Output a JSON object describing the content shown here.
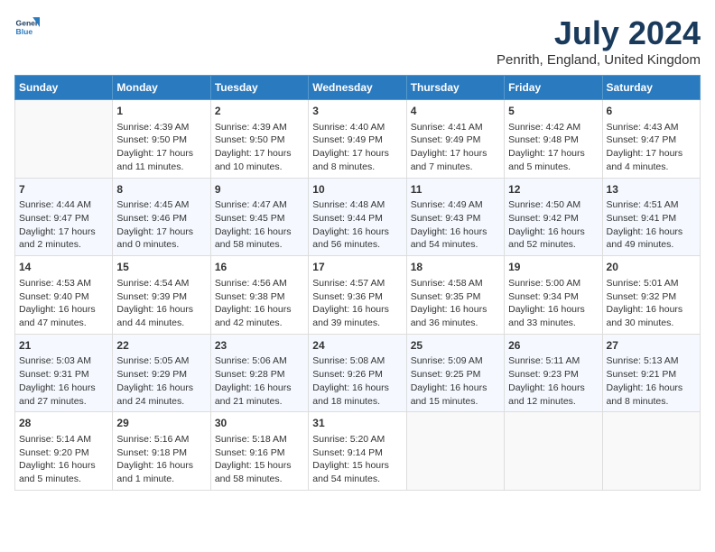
{
  "logo": {
    "text_general": "General",
    "text_blue": "Blue"
  },
  "title": "July 2024",
  "subtitle": "Penrith, England, United Kingdom",
  "days_header": [
    "Sunday",
    "Monday",
    "Tuesday",
    "Wednesday",
    "Thursday",
    "Friday",
    "Saturday"
  ],
  "weeks": [
    [
      {
        "day": "",
        "content": ""
      },
      {
        "day": "1",
        "content": "Sunrise: 4:39 AM\nSunset: 9:50 PM\nDaylight: 17 hours\nand 11 minutes."
      },
      {
        "day": "2",
        "content": "Sunrise: 4:39 AM\nSunset: 9:50 PM\nDaylight: 17 hours\nand 10 minutes."
      },
      {
        "day": "3",
        "content": "Sunrise: 4:40 AM\nSunset: 9:49 PM\nDaylight: 17 hours\nand 8 minutes."
      },
      {
        "day": "4",
        "content": "Sunrise: 4:41 AM\nSunset: 9:49 PM\nDaylight: 17 hours\nand 7 minutes."
      },
      {
        "day": "5",
        "content": "Sunrise: 4:42 AM\nSunset: 9:48 PM\nDaylight: 17 hours\nand 5 minutes."
      },
      {
        "day": "6",
        "content": "Sunrise: 4:43 AM\nSunset: 9:47 PM\nDaylight: 17 hours\nand 4 minutes."
      }
    ],
    [
      {
        "day": "7",
        "content": "Sunrise: 4:44 AM\nSunset: 9:47 PM\nDaylight: 17 hours\nand 2 minutes."
      },
      {
        "day": "8",
        "content": "Sunrise: 4:45 AM\nSunset: 9:46 PM\nDaylight: 17 hours\nand 0 minutes."
      },
      {
        "day": "9",
        "content": "Sunrise: 4:47 AM\nSunset: 9:45 PM\nDaylight: 16 hours\nand 58 minutes."
      },
      {
        "day": "10",
        "content": "Sunrise: 4:48 AM\nSunset: 9:44 PM\nDaylight: 16 hours\nand 56 minutes."
      },
      {
        "day": "11",
        "content": "Sunrise: 4:49 AM\nSunset: 9:43 PM\nDaylight: 16 hours\nand 54 minutes."
      },
      {
        "day": "12",
        "content": "Sunrise: 4:50 AM\nSunset: 9:42 PM\nDaylight: 16 hours\nand 52 minutes."
      },
      {
        "day": "13",
        "content": "Sunrise: 4:51 AM\nSunset: 9:41 PM\nDaylight: 16 hours\nand 49 minutes."
      }
    ],
    [
      {
        "day": "14",
        "content": "Sunrise: 4:53 AM\nSunset: 9:40 PM\nDaylight: 16 hours\nand 47 minutes."
      },
      {
        "day": "15",
        "content": "Sunrise: 4:54 AM\nSunset: 9:39 PM\nDaylight: 16 hours\nand 44 minutes."
      },
      {
        "day": "16",
        "content": "Sunrise: 4:56 AM\nSunset: 9:38 PM\nDaylight: 16 hours\nand 42 minutes."
      },
      {
        "day": "17",
        "content": "Sunrise: 4:57 AM\nSunset: 9:36 PM\nDaylight: 16 hours\nand 39 minutes."
      },
      {
        "day": "18",
        "content": "Sunrise: 4:58 AM\nSunset: 9:35 PM\nDaylight: 16 hours\nand 36 minutes."
      },
      {
        "day": "19",
        "content": "Sunrise: 5:00 AM\nSunset: 9:34 PM\nDaylight: 16 hours\nand 33 minutes."
      },
      {
        "day": "20",
        "content": "Sunrise: 5:01 AM\nSunset: 9:32 PM\nDaylight: 16 hours\nand 30 minutes."
      }
    ],
    [
      {
        "day": "21",
        "content": "Sunrise: 5:03 AM\nSunset: 9:31 PM\nDaylight: 16 hours\nand 27 minutes."
      },
      {
        "day": "22",
        "content": "Sunrise: 5:05 AM\nSunset: 9:29 PM\nDaylight: 16 hours\nand 24 minutes."
      },
      {
        "day": "23",
        "content": "Sunrise: 5:06 AM\nSunset: 9:28 PM\nDaylight: 16 hours\nand 21 minutes."
      },
      {
        "day": "24",
        "content": "Sunrise: 5:08 AM\nSunset: 9:26 PM\nDaylight: 16 hours\nand 18 minutes."
      },
      {
        "day": "25",
        "content": "Sunrise: 5:09 AM\nSunset: 9:25 PM\nDaylight: 16 hours\nand 15 minutes."
      },
      {
        "day": "26",
        "content": "Sunrise: 5:11 AM\nSunset: 9:23 PM\nDaylight: 16 hours\nand 12 minutes."
      },
      {
        "day": "27",
        "content": "Sunrise: 5:13 AM\nSunset: 9:21 PM\nDaylight: 16 hours\nand 8 minutes."
      }
    ],
    [
      {
        "day": "28",
        "content": "Sunrise: 5:14 AM\nSunset: 9:20 PM\nDaylight: 16 hours\nand 5 minutes."
      },
      {
        "day": "29",
        "content": "Sunrise: 5:16 AM\nSunset: 9:18 PM\nDaylight: 16 hours\nand 1 minute."
      },
      {
        "day": "30",
        "content": "Sunrise: 5:18 AM\nSunset: 9:16 PM\nDaylight: 15 hours\nand 58 minutes."
      },
      {
        "day": "31",
        "content": "Sunrise: 5:20 AM\nSunset: 9:14 PM\nDaylight: 15 hours\nand 54 minutes."
      },
      {
        "day": "",
        "content": ""
      },
      {
        "day": "",
        "content": ""
      },
      {
        "day": "",
        "content": ""
      }
    ]
  ]
}
